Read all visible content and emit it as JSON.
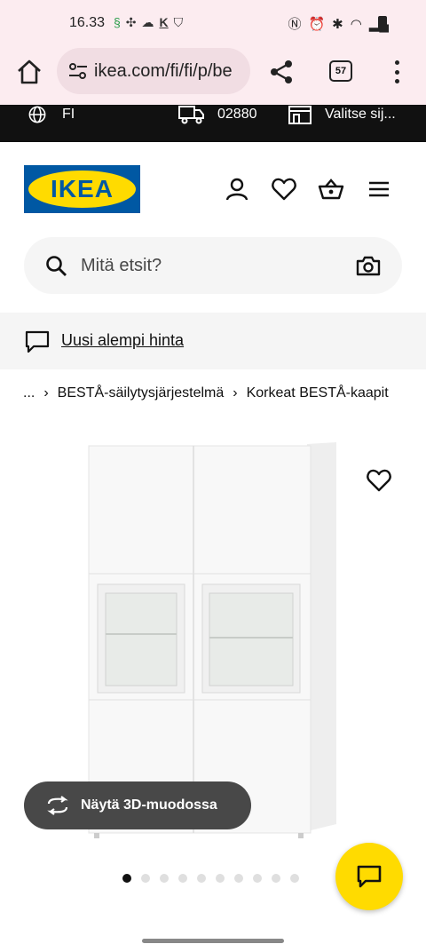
{
  "status_bar": {
    "time": "16.33",
    "tabs_count": "57"
  },
  "browser": {
    "url": "ikea.com/fi/fi/p/be"
  },
  "top_strip": {
    "language": "FI",
    "postcode": "02880",
    "store": "Valitse sij..."
  },
  "header": {
    "logo_text": "IKEA"
  },
  "search": {
    "placeholder": "Mitä etsit?"
  },
  "banner": {
    "link": "Uusi alempi hinta"
  },
  "breadcrumb": {
    "ellipsis": "...",
    "items": [
      "BESTÅ-säilytysjärjestelmä",
      "Korkeat BESTÅ-kaapit"
    ]
  },
  "product": {
    "view_3d_label": "Näytä 3D-muodossa",
    "gallery": {
      "total": 10,
      "active": 1
    }
  },
  "colors": {
    "brand_blue": "#0058a3",
    "brand_yellow": "#ffdb00",
    "strip": "#111111"
  },
  "icons": [
    "home-icon",
    "tune-icon",
    "share-icon",
    "more-icon",
    "globe-icon",
    "truck-icon",
    "store-icon",
    "account-icon",
    "heart-icon",
    "basket-icon",
    "menu-icon",
    "search-icon",
    "camera-icon",
    "chat-icon",
    "rotate-3d-icon"
  ]
}
